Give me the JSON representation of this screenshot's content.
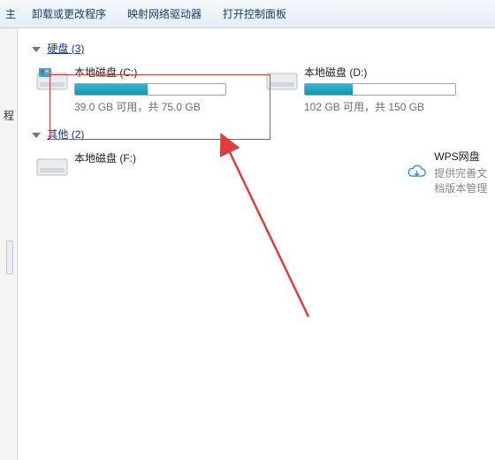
{
  "toolbar": {
    "partial": "主",
    "items": [
      "卸载或更改程序",
      "映射网络驱动器",
      "打开控制面板"
    ]
  },
  "sidebar": {
    "stub": "程"
  },
  "groups": {
    "hdd": {
      "label": "硬盘",
      "count": "(3)"
    },
    "other": {
      "label": "其他",
      "count": "(2)"
    }
  },
  "drives": {
    "c": {
      "name": "本地磁盘 (C:)",
      "cap": "39.0 GB 可用，共 75.0 GB",
      "fill_pct": 48
    },
    "d": {
      "name": "本地磁盘 (D:)",
      "cap": "102 GB 可用，共 150 GB",
      "fill_pct": 32
    },
    "f": {
      "name": "本地磁盘 (F:)",
      "cap": ""
    }
  },
  "cloud": {
    "title": "WPS网盘",
    "subtitle": "提供完善文档版本管理"
  }
}
